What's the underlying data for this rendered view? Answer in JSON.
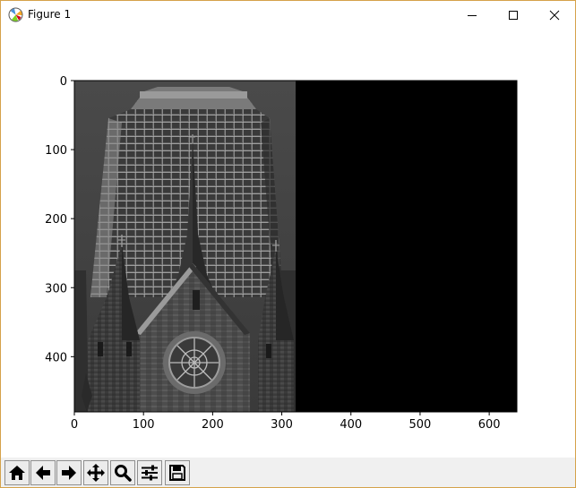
{
  "window": {
    "title": "Figure 1",
    "icon": "matplotlib-logo-icon",
    "controls": [
      "minimize-icon",
      "maximize-icon",
      "close-icon"
    ]
  },
  "chart_data": {
    "type": "image",
    "content": "grayscale photo of a church spire in front of a glass office tower, left half; right half black",
    "x_ticks": [
      0,
      100,
      200,
      300,
      400,
      500,
      600
    ],
    "y_ticks": [
      0,
      100,
      200,
      300,
      400
    ],
    "xlim": [
      0,
      640
    ],
    "ylim": [
      480,
      0
    ],
    "regions": [
      {
        "x": [
          0,
          320
        ],
        "fill": "grayscale photo"
      },
      {
        "x": [
          320,
          640
        ],
        "fill": "#000000"
      }
    ]
  },
  "toolbar": {
    "buttons": [
      {
        "icon": "home-icon",
        "name": "home-button"
      },
      {
        "icon": "back-arrow-icon",
        "name": "back-button"
      },
      {
        "icon": "forward-arrow-icon",
        "name": "forward-button"
      },
      {
        "icon": "pan-move-icon",
        "name": "pan-button"
      },
      {
        "icon": "zoom-magnifier-icon",
        "name": "zoom-button"
      },
      {
        "icon": "sliders-icon",
        "name": "configure-subplots-button"
      },
      {
        "icon": "floppy-disk-icon",
        "name": "save-button"
      }
    ]
  }
}
